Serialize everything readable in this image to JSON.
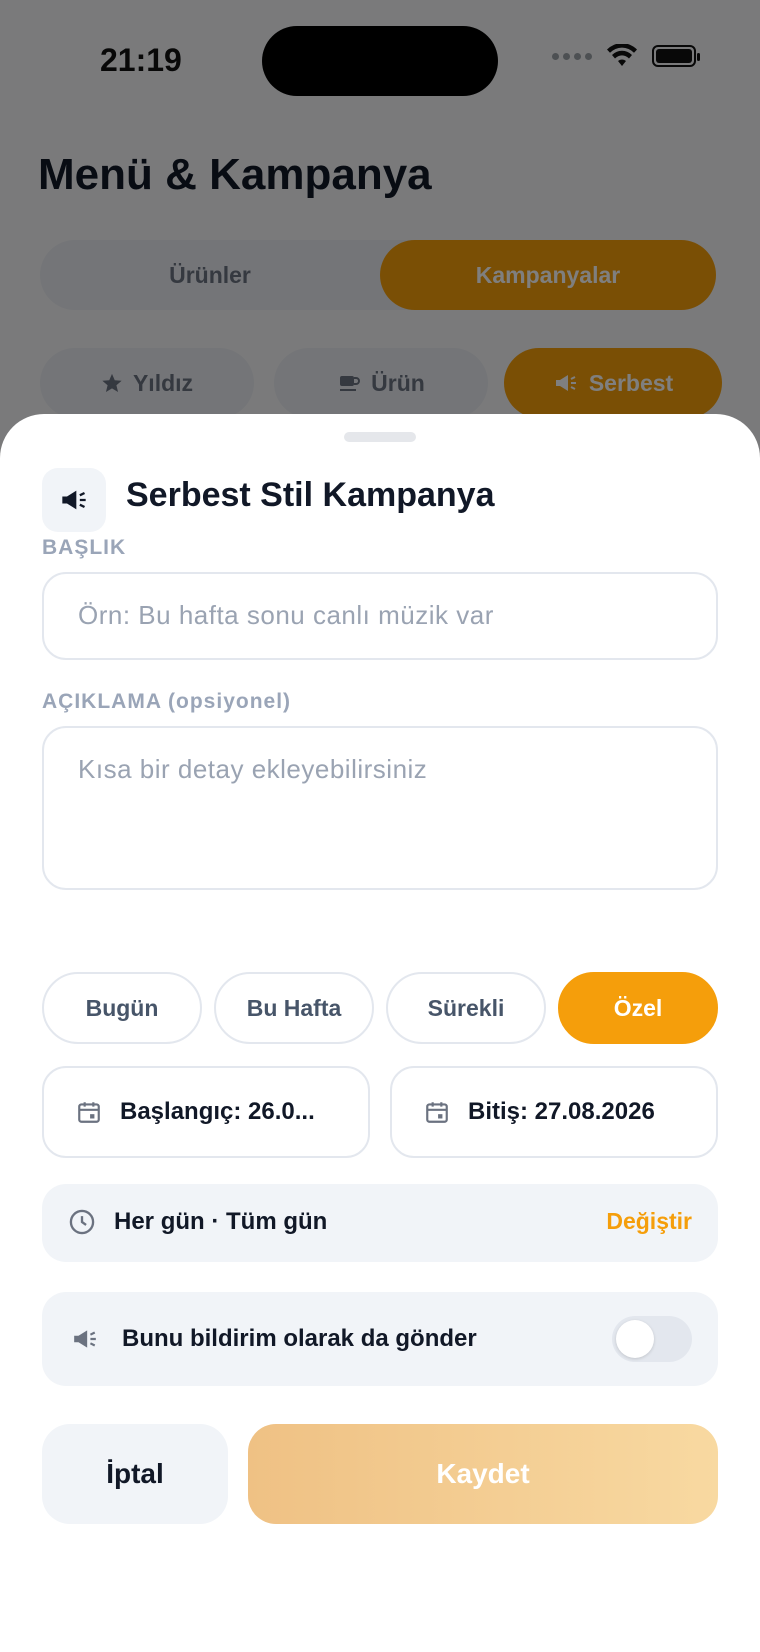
{
  "status_bar": {
    "time": "21:19"
  },
  "page": {
    "title": "Menü & Kampanya",
    "segments": [
      "Ürünler",
      "Kampanyalar"
    ],
    "segment_selected": "Kampanyalar",
    "type_chips": [
      {
        "label": "Yıldız",
        "icon": "star-icon"
      },
      {
        "label": "Ürün",
        "icon": "coffee-icon"
      },
      {
        "label": "Serbest",
        "icon": "megaphone-icon",
        "selected": true
      }
    ]
  },
  "sheet": {
    "icon": "megaphone-icon",
    "title": "Serbest Stil Kampanya",
    "title_label": "BAŞLIK",
    "title_placeholder": "Örn: Bu hafta sonu canlı müzik var",
    "description_label": "AÇIKLAMA (opsiyonel)",
    "description_placeholder": "Kısa bir detay ekleyebilirsiniz",
    "duration_options": [
      "Bugün",
      "Bu Hafta",
      "Sürekli",
      "Özel"
    ],
    "duration_selected": "Özel",
    "start_date": "Başlangıç: 26.0...",
    "end_date": "Bitiş: 27.08.2026",
    "schedule_text": "Her gün · Tüm gün",
    "schedule_change": "Değiştir",
    "notify_label": "Bunu bildirim olarak da gönder",
    "notify_enabled": false,
    "cancel_label": "İptal",
    "save_label": "Kaydet"
  },
  "colors": {
    "accent": "#f59e0b",
    "text_primary": "#111827",
    "muted": "#9aa5b8"
  }
}
